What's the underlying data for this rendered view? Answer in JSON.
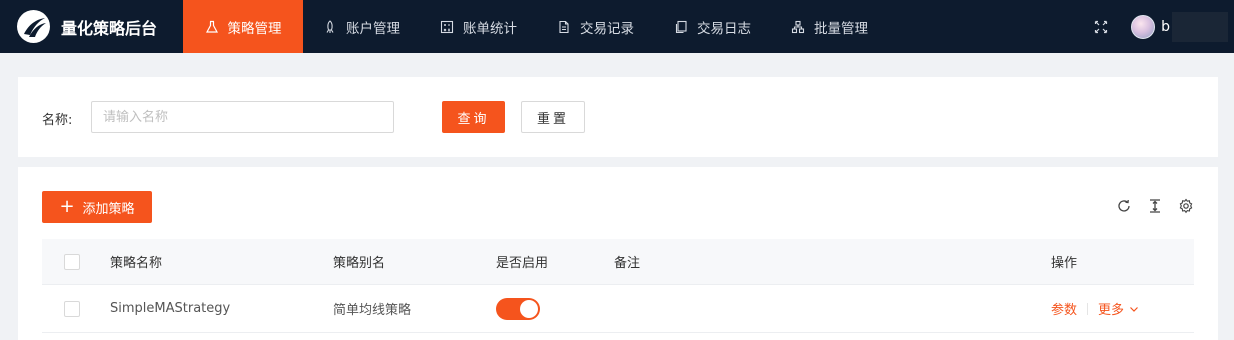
{
  "app": {
    "title": "量化策略后台",
    "accent_color": "#f5541d",
    "nav_bg_color": "#0d1b2e"
  },
  "nav": {
    "items": [
      {
        "label": "策略管理",
        "icon": "flask-icon",
        "active": true
      },
      {
        "label": "账户管理",
        "icon": "rocket-icon",
        "active": false
      },
      {
        "label": "账单统计",
        "icon": "calculator-icon",
        "active": false
      },
      {
        "label": "交易记录",
        "icon": "document-icon",
        "active": false
      },
      {
        "label": "交易日志",
        "icon": "copy-icon",
        "active": false
      },
      {
        "label": "批量管理",
        "icon": "cluster-icon",
        "active": false
      }
    ],
    "user_initial": "b"
  },
  "search": {
    "label": "名称:",
    "placeholder": "请输入名称",
    "value": "",
    "query_button": "查询",
    "reset_button": "重置"
  },
  "table": {
    "add_button": "添加策略",
    "toolbar_icons": [
      "refresh-icon",
      "column-height-icon",
      "settings-icon"
    ],
    "columns": [
      "策略名称",
      "策略别名",
      "是否启用",
      "备注",
      "操作"
    ],
    "rows": [
      {
        "name": "SimpleMAStrategy",
        "alias": "简单均线策略",
        "enabled": true,
        "remark": "",
        "action_params": "参数",
        "action_more": "更多"
      }
    ]
  }
}
